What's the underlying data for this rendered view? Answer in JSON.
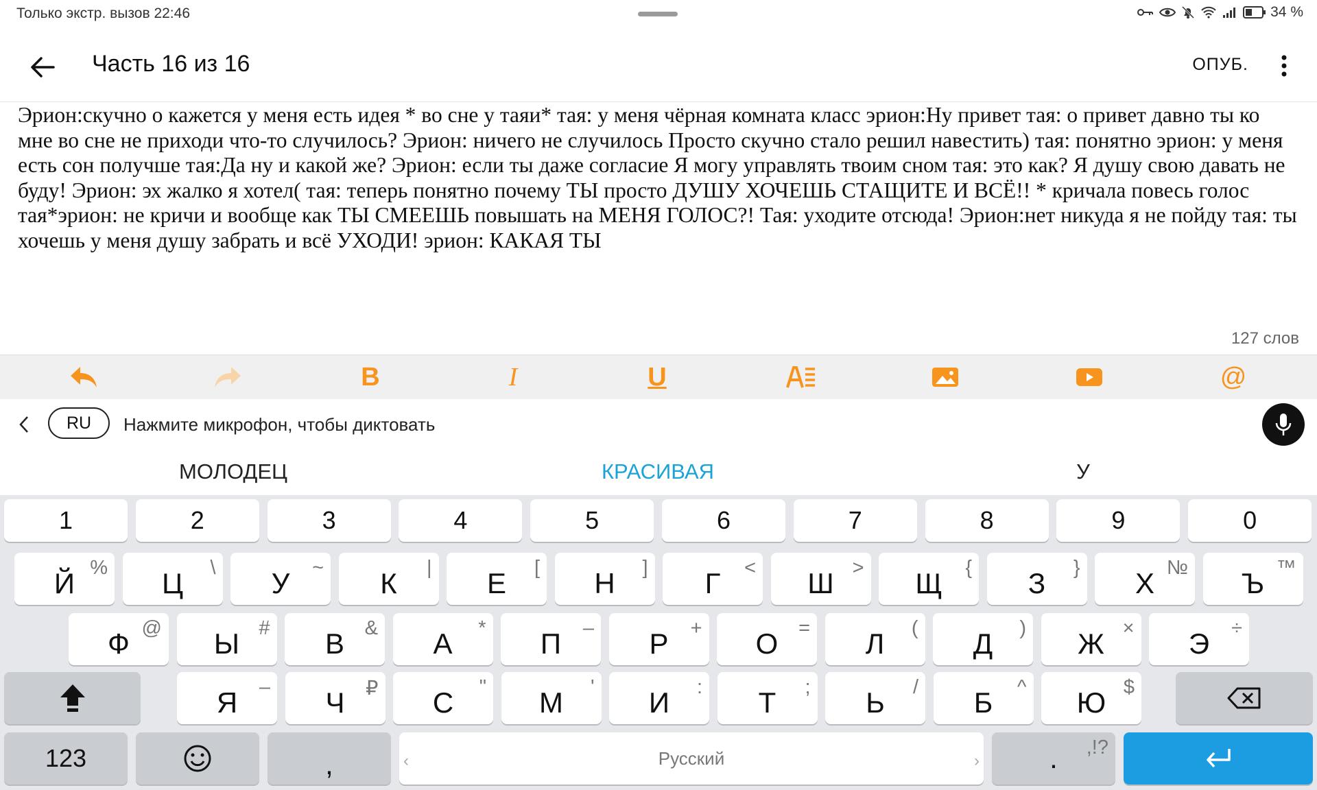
{
  "status_bar": {
    "left_text": "Только экстр. вызов 22:46",
    "battery": "34 %",
    "icons": [
      "key-icon",
      "eye-icon",
      "bell-off-icon",
      "wifi-icon",
      "signal-icon",
      "battery-icon"
    ]
  },
  "app_bar": {
    "title": "Часть 16 из 16",
    "publish": "ОПУБ."
  },
  "editor": {
    "text": "Эрион:скучно о кажется у меня есть идея  * во сне у таяи* тая: у меня чёрная комната класс эрион:Ну привет тая: о привет давно ты ко мне во сне не приходи что-то случилось? Эрион: ничего не случилось Просто скучно стало решил навестить) тая: понятно эрион: у меня есть сон получше тая:Да ну и какой же? Эрион: если ты даже согласие Я могу управлять твоим сном тая: это как? Я душу свою давать не буду! Эрион: эх жалко я хотел( тая: теперь понятно почему ТЫ просто ДУШУ ХОЧЕШЬ СТАЩИТЕ И ВСЁ!! * кричала повесь голос тая*эрион: не кричи и вообще как ТЫ СМЕЕШЬ повышать на МЕНЯ ГОЛОС?! Тая: уходите отсюда! Эрион:нет никуда я не пойду тая: ты хочешь у меня душу забрать и всё УХОДИ! эрион: КАКАЯ ТЫ",
    "word_count": "127 слов"
  },
  "format_toolbar": {
    "accent": "#f7941d",
    "bold_label": "B",
    "italic_label": "I",
    "underline_label": "U",
    "at_label": "@"
  },
  "keyboard": {
    "language": "RU",
    "dictation_hint": "Нажмите микрофон, чтобы диктовать",
    "suggestions": [
      "МОЛОДЕЦ",
      "КРАСИВАЯ",
      "У"
    ],
    "suggestion_highlight_color": "#1ba3d8",
    "row_numbers": [
      "1",
      "2",
      "3",
      "4",
      "5",
      "6",
      "7",
      "8",
      "9",
      "0"
    ],
    "row1": [
      {
        "k": "Й",
        "s": "%"
      },
      {
        "k": "Ц",
        "s": "\\"
      },
      {
        "k": "У",
        "s": "~"
      },
      {
        "k": "К",
        "s": "|"
      },
      {
        "k": "Е",
        "s": "["
      },
      {
        "k": "Н",
        "s": "]"
      },
      {
        "k": "Г",
        "s": "<"
      },
      {
        "k": "Ш",
        "s": ">"
      },
      {
        "k": "Щ",
        "s": "{"
      },
      {
        "k": "З",
        "s": "}"
      },
      {
        "k": "Х",
        "s": "№"
      },
      {
        "k": "Ъ",
        "s": "™"
      }
    ],
    "row2": [
      {
        "k": "Ф",
        "s": "@"
      },
      {
        "k": "Ы",
        "s": "#"
      },
      {
        "k": "В",
        "s": "&"
      },
      {
        "k": "А",
        "s": "*"
      },
      {
        "k": "П",
        "s": "–"
      },
      {
        "k": "Р",
        "s": "+"
      },
      {
        "k": "О",
        "s": "="
      },
      {
        "k": "Л",
        "s": "("
      },
      {
        "k": "Д",
        "s": ")"
      },
      {
        "k": "Ж",
        "s": "×"
      },
      {
        "k": "Э",
        "s": "÷"
      }
    ],
    "row3": [
      {
        "k": "Я",
        "s": "–"
      },
      {
        "k": "Ч",
        "s": "₽"
      },
      {
        "k": "С",
        "s": "\""
      },
      {
        "k": "М",
        "s": "'"
      },
      {
        "k": "И",
        "s": ":"
      },
      {
        "k": "Т",
        "s": ";"
      },
      {
        "k": "Ь",
        "s": "/"
      },
      {
        "k": "Б",
        "s": "^"
      },
      {
        "k": "Ю",
        "s": "$"
      }
    ],
    "numbers_key": "123",
    "comma_key": ",",
    "space_label": "Русский",
    "period_key": ".",
    "period_secondary": ",!?",
    "enter_color": "#1c9de2"
  }
}
